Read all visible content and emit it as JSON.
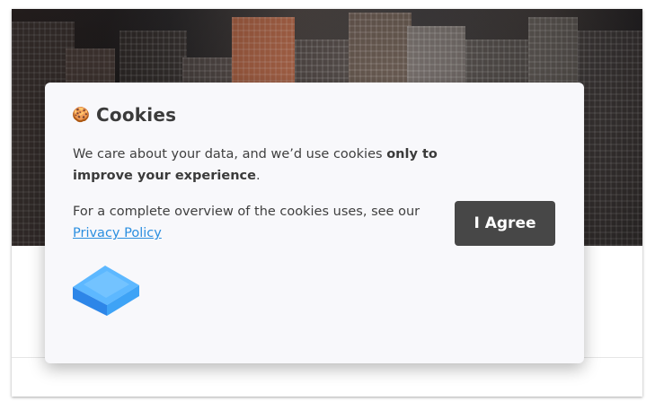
{
  "cookie_modal": {
    "emoji": "🍪",
    "title": "Cookies",
    "intro_prefix": "We care about your data, and we’d use cookies ",
    "intro_bold": "only to improve your experience",
    "intro_suffix": ".",
    "policy_prefix": "For a complete overview of the cookies uses, see our",
    "policy_link": "Privacy Policy",
    "agree_label": "I Agree",
    "logo_icon": "stack-logo-icon"
  },
  "colors": {
    "modal_bg": "#f8f8fb",
    "button_bg": "#474747",
    "link": "#2b8fe0",
    "logo_light": "#5db8ff",
    "logo_dark": "#2d86e8"
  }
}
